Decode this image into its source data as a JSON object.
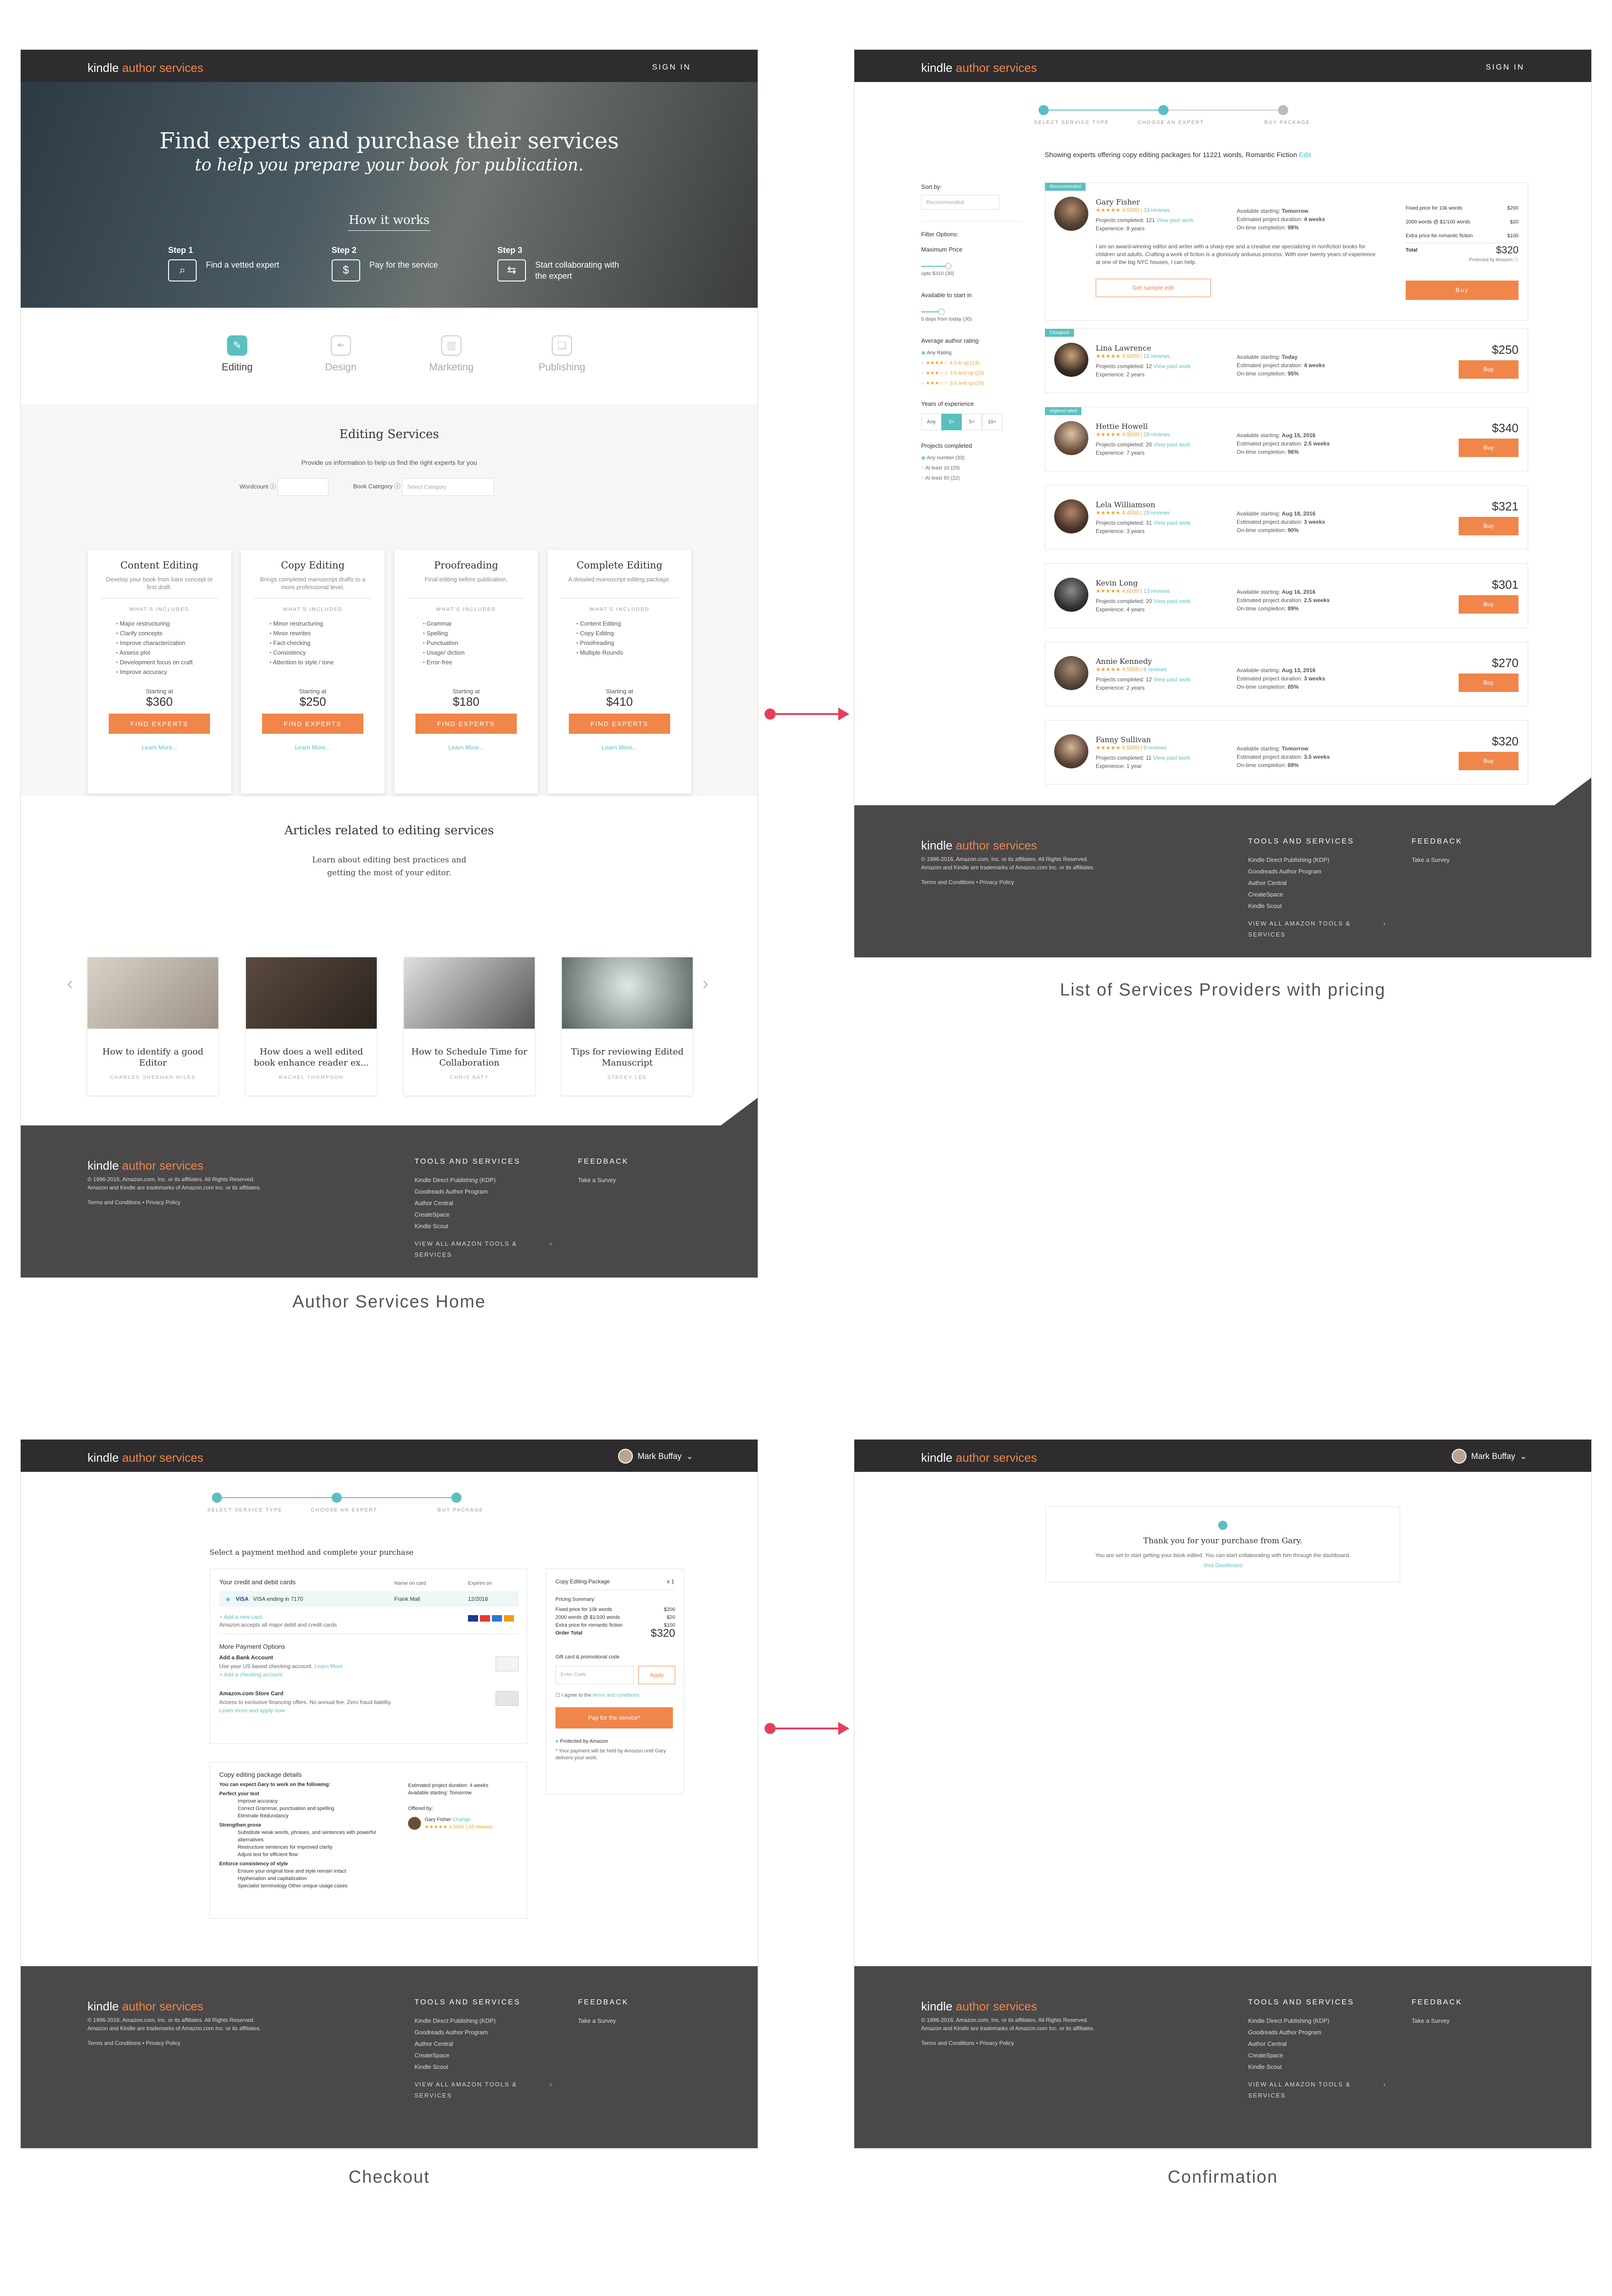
{
  "brand": {
    "kindle": "kindle",
    "author_services": "author services",
    "accent": "#f0864a",
    "teal": "#5bbfbf",
    "dark": "#2e2c2e"
  },
  "nav": {
    "sign_in": "SIGN IN",
    "user_name": "Mark Buffay"
  },
  "captions": {
    "home": "Author Services Home",
    "list": "List of Services Providers with pricing",
    "checkout": "Checkout",
    "confirmation": "Confirmation"
  },
  "footer": {
    "copyright": "© 1996-2016, Amazon.com, Inc. or its affiliates. All Rights Reserved.",
    "trademarks": "Amazon and Kindle are trademarks of Amazon.com Inc. or its affiliates.",
    "terms": "Terms and Conditions • Privacy Policy",
    "tools_title": "TOOLS AND SERVICES",
    "tools": [
      "Kindle Direct Publishing (KDP)",
      "Goodreads Author Program",
      "Author Central",
      "CreateSpace",
      "Kindle Scout"
    ],
    "view_all": "VIEW ALL AMAZON TOOLS & SERVICES",
    "feedback_title": "FEEDBACK",
    "survey": "Take a Survey"
  },
  "steps": [
    "SELECT SERVICE TYPE",
    "CHOOSE AN EXPERT",
    "BUY PACKAGE"
  ],
  "home": {
    "hero_title": "Find experts and purchase their services",
    "hero_sub": "to help you prepare your book for publication.",
    "how_it_works": "How it works",
    "hero_steps": [
      {
        "label": "Step 1",
        "text": "Find a vetted expert"
      },
      {
        "label": "Step 2",
        "text": "Pay for the service"
      },
      {
        "label": "Step 3",
        "text": "Start collaborating with the expert"
      }
    ],
    "tabs": [
      "Editing",
      "Design",
      "Marketing",
      "Publishing"
    ],
    "editing_title": "Editing Services",
    "editing_sub": "Provide us information to help us find the right experts for you",
    "wordcount_label": "Wordcount ⓘ",
    "category_label": "Book Category ⓘ",
    "category_placeholder": "Select Category",
    "what_included": "WHAT'S INCLUDED",
    "starting_at": "Starting at",
    "find_experts": "FIND EXPERTS",
    "learn_more": "Learn More...",
    "packages": [
      {
        "title": "Content Editing",
        "desc": "Develop your book from bare concept or first draft.",
        "items": [
          "Major restructuring",
          "Clarify concepts",
          "Improve characterization",
          "Assess plot",
          "Development focus on craft",
          "Improve accuracy"
        ],
        "price": "$360"
      },
      {
        "title": "Copy Editing",
        "desc": "Brings completed manuscript drafts to a more professional level.",
        "items": [
          "Minor restructuring",
          "Minor rewrites",
          "Fact-checking",
          "Consistency",
          "Attention to style / tone"
        ],
        "price": "$250"
      },
      {
        "title": "Proofreading",
        "desc": "Final editing before publication.",
        "items": [
          "Grammar",
          "Spelling",
          "Punctuation",
          "Usage/ diction",
          "Error-free"
        ],
        "price": "$180"
      },
      {
        "title": "Complete Editing",
        "desc": "A detailed manuscript editing package.",
        "items": [
          "Content Editing",
          "Copy Editing",
          "Proofreading",
          "Multiple Rounds"
        ],
        "price": "$410"
      }
    ],
    "articles_title": "Articles related to editing services",
    "articles_sub": "Learn about editing best practices and getting the most of your editor.",
    "articles": [
      {
        "title": "How to identify a good Editor",
        "author": "CHARLES SHEEHAN-MILES"
      },
      {
        "title": "How does a well edited book enhance reader ex...",
        "author": "RACHEL THOMPSON"
      },
      {
        "title": "How to Schedule Time for Collaboration",
        "author": "CHRIS BATY"
      },
      {
        "title": "Tips for reviewing Edited Manuscript",
        "author": "STACEY LEE"
      }
    ],
    "prev": "‹",
    "next": "›"
  },
  "list": {
    "showing": "Showing experts offering copy editing packages for 11221 words, Romantic Fiction",
    "edit": "Edit",
    "sort_by": "Sort by:",
    "sort_value": "Recommended",
    "filter_options": "Filter Options:",
    "max_price": "Maximum Price",
    "max_price_value": "upto $310 (30)",
    "available": "Available to start in",
    "available_value": "5 days from today (30)",
    "avg_rating": "Average author rating",
    "ratings": [
      "Any Rating",
      "★★★★☆ 4.0 & up (13)",
      "★★★☆☆ 3.5 and up (23)",
      "★★★☆☆ 3.0 and up (25)"
    ],
    "years": "Years of experience",
    "years_opts": [
      "Any",
      "3+",
      "5+",
      "10+"
    ],
    "projects": "Projects completed",
    "projects_opts": [
      "Any number (33)",
      "At least 10 (29)",
      "At least 50 (22)"
    ],
    "view_past": "View past work",
    "providers": [
      {
        "badge": "Recommended",
        "name": "Gary Fisher",
        "rating": "★★★★★ 4.5000",
        "reviews": "33 reviews",
        "projects": "121",
        "exp": "8 years",
        "avail": "Tomorrow",
        "dur": "4 weeks",
        "ontime": "98%",
        "price": "$320",
        "bio": "I am an award-winning editor and writer with a sharp eye and a creative ear specializing in nonfiction books for children and adults. Crafting a work of fiction is a gloriously arduous process. With over twenty years of experience at one of the big NYC houses, I can help.",
        "sample": "Get sample edit",
        "fixed": "Fixed price for 10k words",
        "fixed_v": "$200",
        "k2": "2000 words @ $1/100 words",
        "k2_v": "$20",
        "extra": "Extra price for romantic fiction",
        "extra_v": "$100",
        "total": "Total",
        "protected": "Protected by Amazon ⓘ"
      },
      {
        "badge": "Cheapest",
        "name": "Lina Lawrence",
        "rating": "★★★★★ 4.5000",
        "reviews": "15 reviews",
        "projects": "12",
        "exp": "2 years",
        "avail": "Today",
        "dur": "4 weeks",
        "ontime": "95%",
        "price": "$250"
      },
      {
        "badge": "Highest rated",
        "name": "Hettie Howell",
        "rating": "★★★★★ 4.9000",
        "reviews": "28 reviews",
        "projects": "20",
        "exp": "7 years",
        "avail": "Aug 15, 2016",
        "dur": "2.5 weeks",
        "ontime": "96%",
        "price": "$340"
      },
      {
        "badge": "",
        "name": "Lela Williamson",
        "rating": "★★★★★ 4.4000",
        "reviews": "29 reviews",
        "projects": "31",
        "exp": "3 years",
        "avail": "Aug 18, 2016",
        "dur": "3 weeks",
        "ontime": "90%",
        "price": "$321"
      },
      {
        "badge": "",
        "name": "Kevin Long",
        "rating": "★★★★★ 4.6000",
        "reviews": "13 reviews",
        "projects": "20",
        "exp": "4 years",
        "avail": "Aug 16, 2016",
        "dur": "2.5 weeks",
        "ontime": "89%",
        "price": "$301"
      },
      {
        "badge": "",
        "name": "Annie Kennedy",
        "rating": "★★★★★ 4.5000",
        "reviews": "8 reviews",
        "projects": "12",
        "exp": "2 years",
        "avail": "Aug 13, 2016",
        "dur": "3 weeks",
        "ontime": "85%",
        "price": "$270"
      },
      {
        "badge": "",
        "name": "Fanny Sullivan",
        "rating": "★★★★★ 4.5000",
        "reviews": "9 reviews",
        "projects": "11",
        "exp": "1 year",
        "avail": "Tomorrow",
        "dur": "3.5 weeks",
        "ontime": "89%",
        "price": "$320"
      }
    ],
    "labels": {
      "projects": "Projects completed:",
      "exp": "Experience:",
      "avail": "Available starting:",
      "dur": "Estimated project duration:",
      "ontime": "On-time completion:",
      "buy": "Buy"
    }
  },
  "checkout": {
    "title": "Select a payment method and complete your purchase",
    "cards_title": "Your credit and debit cards",
    "name_on_card": "Name on card",
    "expires_on": "Expires on",
    "card_brand": "VISA",
    "card_desc": "VISA ending in 7170",
    "card_name": "Frank Mall",
    "card_exp": "12/2018",
    "add_card": "+ Add a new card",
    "accepts": "Amazon accepts all major debit and credit cards",
    "more_title": "More Payment Options",
    "bank_title": "Add a Bank Account",
    "bank_desc": "Use your US based checking account.",
    "bank_learn": "Learn More",
    "bank_add": "+ Add a checking account",
    "store_title": "Amazon.com Store Card",
    "store_desc": "Access to exclusive financing offers. No annual fee. Zero fraud liability.",
    "store_learn": "Learn more and apply now",
    "pkg_title": "Copy Editing Package",
    "pkg_qty": "x 1",
    "pricing_summary": "Pricing Summary:",
    "line1": "Fixed price for 10k words",
    "line1_v": "$200",
    "line2": "2000 words @ $1/100 words",
    "line2_v": "$20",
    "line3": "Extra price for romantic fiction",
    "line3_v": "$100",
    "order_total": "Order Total",
    "order_total_v": "$320",
    "gift": "Gift card & promotional code",
    "enter_code": "Enter Code",
    "apply": "Apply",
    "agree": "I agree to the",
    "terms_link": "terms and conditions",
    "pay": "Pay for the service*",
    "protected": "Protected by Amazon",
    "protected_desc": "* Your payment will be held by Amazon until Gary delivers your work.",
    "details_title": "Copy editing package details",
    "details_intro": "You can expect Gary to work on the following:",
    "perfect": "Perfect your text",
    "perfect_items": [
      "Improve accuracy",
      "Correct Grammar, punctuation and spelling",
      "Eliminate Redundancy"
    ],
    "strengthen": "Strengthen prose",
    "strengthen_items": [
      "Substitute weak words, phrases, and sentences with powerful alternatives",
      "Restructure sentences for improved clarity",
      "Adjust text for efficient flow"
    ],
    "enforce": "Enforce consistency of style",
    "enforce_items": [
      "Ensure your original tone and style remain intact",
      "Hyphenation and capitalization",
      "Specialist terminology Other unique usage cases"
    ],
    "est": "Estimated project duration: 4 weeks",
    "avail": "Available starting: Tomorrow",
    "offered": "Offered by:",
    "offered_name": "Gary Fisher",
    "change": "Change",
    "offered_rating": "★★★★★ 4.5000 | 33 reviews"
  },
  "confirm": {
    "title": "Thank you for your purchase from Gary.",
    "sub": "You are set to start getting your book edited. You can start collaborating with him through the dashboard.",
    "link": "Visit Dashboard"
  }
}
